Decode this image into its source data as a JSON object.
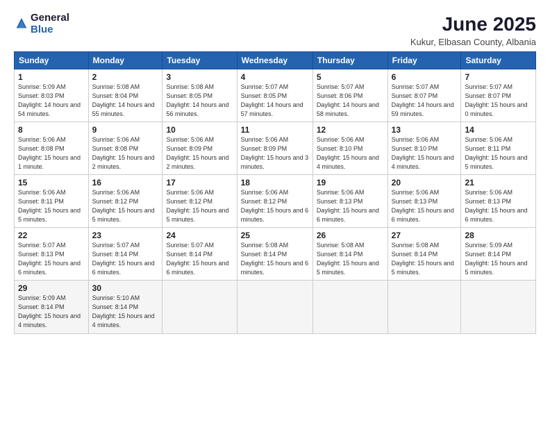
{
  "logo": {
    "general": "General",
    "blue": "Blue"
  },
  "title": "June 2025",
  "subtitle": "Kukur, Elbasan County, Albania",
  "days_of_week": [
    "Sunday",
    "Monday",
    "Tuesday",
    "Wednesday",
    "Thursday",
    "Friday",
    "Saturday"
  ],
  "weeks": [
    [
      {
        "day": "1",
        "sunrise": "5:09 AM",
        "sunset": "8:03 PM",
        "daylight": "14 hours and 54 minutes."
      },
      {
        "day": "2",
        "sunrise": "5:08 AM",
        "sunset": "8:04 PM",
        "daylight": "14 hours and 55 minutes."
      },
      {
        "day": "3",
        "sunrise": "5:08 AM",
        "sunset": "8:05 PM",
        "daylight": "14 hours and 56 minutes."
      },
      {
        "day": "4",
        "sunrise": "5:07 AM",
        "sunset": "8:05 PM",
        "daylight": "14 hours and 57 minutes."
      },
      {
        "day": "5",
        "sunrise": "5:07 AM",
        "sunset": "8:06 PM",
        "daylight": "14 hours and 58 minutes."
      },
      {
        "day": "6",
        "sunrise": "5:07 AM",
        "sunset": "8:07 PM",
        "daylight": "14 hours and 59 minutes."
      },
      {
        "day": "7",
        "sunrise": "5:07 AM",
        "sunset": "8:07 PM",
        "daylight": "15 hours and 0 minutes."
      }
    ],
    [
      {
        "day": "8",
        "sunrise": "5:06 AM",
        "sunset": "8:08 PM",
        "daylight": "15 hours and 1 minute."
      },
      {
        "day": "9",
        "sunrise": "5:06 AM",
        "sunset": "8:08 PM",
        "daylight": "15 hours and 2 minutes."
      },
      {
        "day": "10",
        "sunrise": "5:06 AM",
        "sunset": "8:09 PM",
        "daylight": "15 hours and 2 minutes."
      },
      {
        "day": "11",
        "sunrise": "5:06 AM",
        "sunset": "8:09 PM",
        "daylight": "15 hours and 3 minutes."
      },
      {
        "day": "12",
        "sunrise": "5:06 AM",
        "sunset": "8:10 PM",
        "daylight": "15 hours and 4 minutes."
      },
      {
        "day": "13",
        "sunrise": "5:06 AM",
        "sunset": "8:10 PM",
        "daylight": "15 hours and 4 minutes."
      },
      {
        "day": "14",
        "sunrise": "5:06 AM",
        "sunset": "8:11 PM",
        "daylight": "15 hours and 5 minutes."
      }
    ],
    [
      {
        "day": "15",
        "sunrise": "5:06 AM",
        "sunset": "8:11 PM",
        "daylight": "15 hours and 5 minutes."
      },
      {
        "day": "16",
        "sunrise": "5:06 AM",
        "sunset": "8:12 PM",
        "daylight": "15 hours and 5 minutes."
      },
      {
        "day": "17",
        "sunrise": "5:06 AM",
        "sunset": "8:12 PM",
        "daylight": "15 hours and 5 minutes."
      },
      {
        "day": "18",
        "sunrise": "5:06 AM",
        "sunset": "8:12 PM",
        "daylight": "15 hours and 6 minutes."
      },
      {
        "day": "19",
        "sunrise": "5:06 AM",
        "sunset": "8:13 PM",
        "daylight": "15 hours and 6 minutes."
      },
      {
        "day": "20",
        "sunrise": "5:06 AM",
        "sunset": "8:13 PM",
        "daylight": "15 hours and 6 minutes."
      },
      {
        "day": "21",
        "sunrise": "5:06 AM",
        "sunset": "8:13 PM",
        "daylight": "15 hours and 6 minutes."
      }
    ],
    [
      {
        "day": "22",
        "sunrise": "5:07 AM",
        "sunset": "8:13 PM",
        "daylight": "15 hours and 6 minutes."
      },
      {
        "day": "23",
        "sunrise": "5:07 AM",
        "sunset": "8:14 PM",
        "daylight": "15 hours and 6 minutes."
      },
      {
        "day": "24",
        "sunrise": "5:07 AM",
        "sunset": "8:14 PM",
        "daylight": "15 hours and 6 minutes."
      },
      {
        "day": "25",
        "sunrise": "5:08 AM",
        "sunset": "8:14 PM",
        "daylight": "15 hours and 6 minutes."
      },
      {
        "day": "26",
        "sunrise": "5:08 AM",
        "sunset": "8:14 PM",
        "daylight": "15 hours and 5 minutes."
      },
      {
        "day": "27",
        "sunrise": "5:08 AM",
        "sunset": "8:14 PM",
        "daylight": "15 hours and 5 minutes."
      },
      {
        "day": "28",
        "sunrise": "5:09 AM",
        "sunset": "8:14 PM",
        "daylight": "15 hours and 5 minutes."
      }
    ],
    [
      {
        "day": "29",
        "sunrise": "5:09 AM",
        "sunset": "8:14 PM",
        "daylight": "15 hours and 4 minutes."
      },
      {
        "day": "30",
        "sunrise": "5:10 AM",
        "sunset": "8:14 PM",
        "daylight": "15 hours and 4 minutes."
      },
      null,
      null,
      null,
      null,
      null
    ]
  ]
}
